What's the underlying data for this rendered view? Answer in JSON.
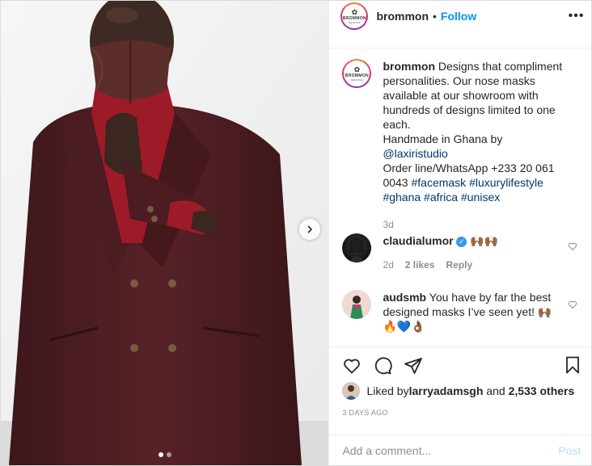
{
  "header": {
    "username": "brommon",
    "separator": "•",
    "follow_label": "Follow",
    "more_label": "•••",
    "logo_text": "BROMMON",
    "logo_sub": "BESPOKE"
  },
  "caption": {
    "username": "brommon",
    "text_1": " Designs that compliment personalities. Our nose masks available at our showroom with hundreds of designs limited to one each.",
    "text_2": "Handmade in Ghana by ",
    "mention": "@laxiristudio",
    "text_3": "Order line/WhatsApp +233 20 061 0043 ",
    "tags": [
      "#facemask",
      "#luxurylifestyle",
      "#ghana",
      "#africa",
      "#unisex"
    ],
    "time": "3d"
  },
  "comments": [
    {
      "username": "claudialumor",
      "text": "🙌🏾🙌🏾",
      "time": "2d",
      "likes": "2 likes",
      "reply": "Reply"
    },
    {
      "username": "audsmb",
      "text": " You have by far the best designed masks I’ve seen yet! 🙌🏾",
      "text_2": "🔥💙👌🏾"
    }
  ],
  "likes": {
    "prefix": "Liked by ",
    "user": "larryadamsgh",
    "middle": " and ",
    "count": "2,533 others"
  },
  "date": "3 DAYS AGO",
  "add_comment": {
    "placeholder": "Add a comment...",
    "post_label": "Post"
  },
  "carousel": {
    "current": 1,
    "total": 2
  },
  "colors": {
    "accent": "#0095f6",
    "link": "#00376b",
    "suit": "#4a1d22",
    "turtleneck": "#a11d2b"
  }
}
